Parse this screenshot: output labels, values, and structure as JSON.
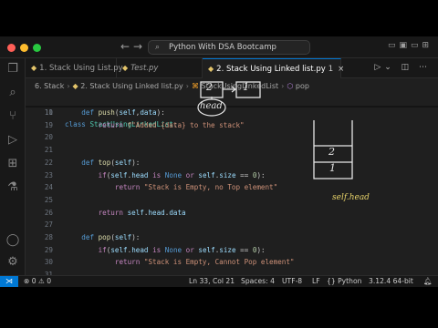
{
  "titlebar": {
    "title": "Python With DSA Bootcamp"
  },
  "tabs": [
    {
      "label": "1. Stack Using List.py"
    },
    {
      "label": "Test.py"
    },
    {
      "label": "2. Stack Using Linked list.py",
      "index": "1"
    }
  ],
  "breadcrumb": {
    "folder": "6. Stack",
    "file": "2. Stack Using Linked list.py",
    "class": "StackUsingLinkedList",
    "method": "pop"
  },
  "editor": {
    "sticky": {
      "number": "10",
      "text": "class StackUsingLinkedList:"
    },
    "lines": [
      {
        "n": "11",
        "t": "    def push(self,data):"
      },
      {
        "n": "19",
        "t": "        return f\"Added {data} to the stack\""
      },
      {
        "n": "20",
        "t": ""
      },
      {
        "n": "21",
        "t": ""
      },
      {
        "n": "22",
        "t": "    def top(self):"
      },
      {
        "n": "23",
        "t": "        if(self.head is None or self.size == 0):"
      },
      {
        "n": "24",
        "t": "            return \"Stack is Empty, no Top element\""
      },
      {
        "n": "25",
        "t": ""
      },
      {
        "n": "26",
        "t": "        return self.head.data"
      },
      {
        "n": "27",
        "t": ""
      },
      {
        "n": "28",
        "t": "    def pop(self):"
      },
      {
        "n": "29",
        "t": "        if(self.head is None or self.size == 0):"
      },
      {
        "n": "30",
        "t": "            return \"Stack is Empty, Cannot Pop element\""
      },
      {
        "n": "31",
        "t": ""
      },
      {
        "n": "32",
        "t": "        dataAtTop = self.head.data"
      },
      {
        "n": "33",
        "t": "        self.head = "
      }
    ],
    "current_line": "33"
  },
  "annotations": {
    "node_values": [
      "2",
      "1"
    ],
    "head_label": "head",
    "stack_values": [
      "2",
      "1"
    ],
    "self_head_label": "self.head"
  },
  "statusbar": {
    "errors": "0",
    "warnings": "0",
    "position": "Ln 33, Col 21",
    "spaces": "Spaces: 4",
    "encoding": "UTF-8",
    "eol": "LF",
    "language": "Python",
    "interpreter": "3.12.4 64-bit"
  }
}
